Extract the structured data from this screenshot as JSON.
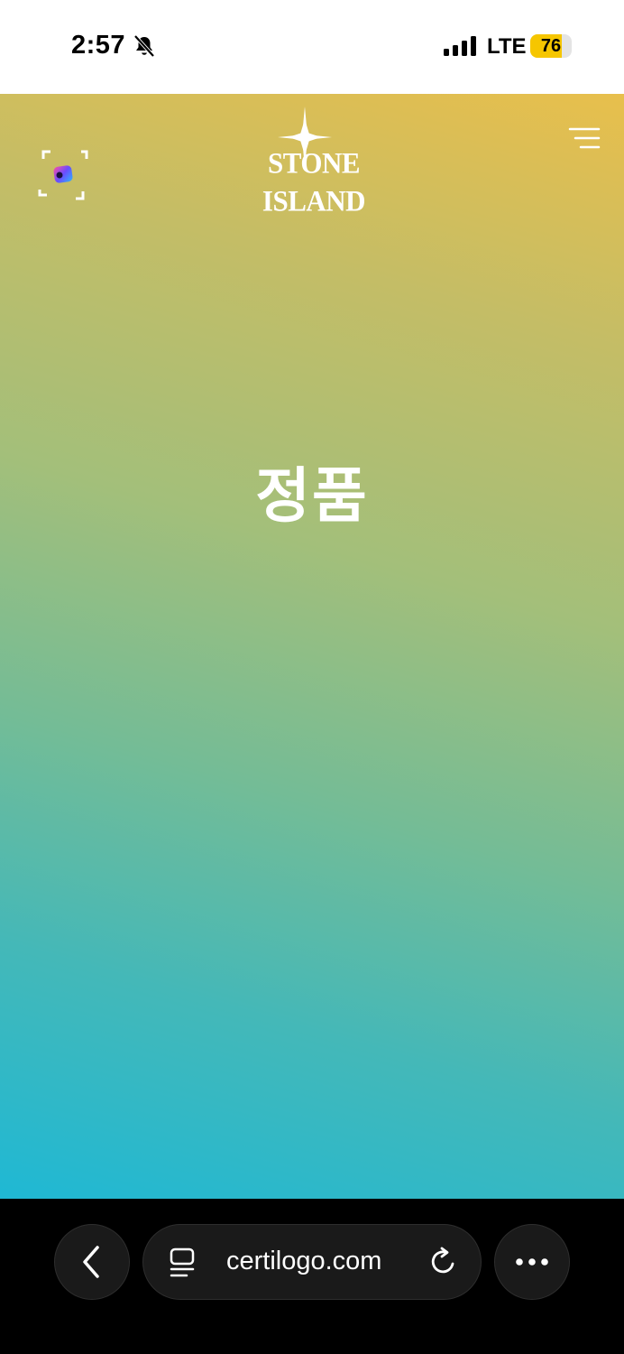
{
  "status_bar": {
    "time": "2:57",
    "network": "LTE",
    "battery_percent": "76",
    "battery_level": 0.76,
    "icons": [
      "bell-slash-icon",
      "signal-icon"
    ]
  },
  "header": {
    "logo_text": "STONE ISLAND",
    "scan_icon": "scan-frame-icon",
    "menu_icon": "hamburger-menu-icon"
  },
  "result": {
    "label": "정품"
  },
  "browser": {
    "url": "certilogo.com",
    "icons": [
      "chevron-left-icon",
      "page-format-icon",
      "reload-icon",
      "more-dots-icon"
    ]
  },
  "colors": {
    "gradient_top": "#e8bf4c",
    "gradient_bottom": "#1fb8d4",
    "battery_fill": "#f6c600"
  }
}
